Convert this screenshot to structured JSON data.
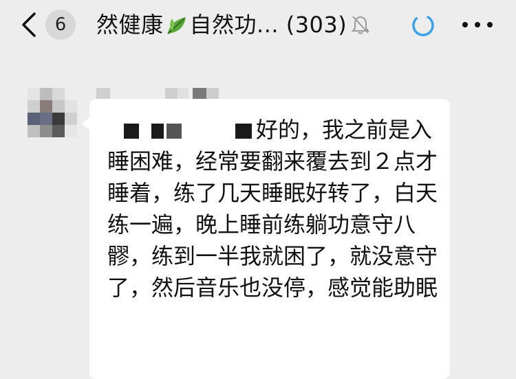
{
  "header": {
    "back_badge_count": "6",
    "title_prefix": "然健康",
    "title_suffix": "自然功... (303)",
    "title_leaf_icon": "leaf-icon",
    "muted_icon": "bell-muted-icon",
    "loading_icon": "loading-ring-icon",
    "loading_color": "#3aa0ea",
    "more_icon": "more-dots-icon"
  },
  "message": {
    "text": "好的，我之前是入睡困难，经常要翻来覆去到２点才睡着，练了几天睡眠好转了，白天练一遍，晚上睡前练躺功意守八髎，练到一半我就困了，就没意守了，然后音乐也没停，感觉能助眠"
  }
}
